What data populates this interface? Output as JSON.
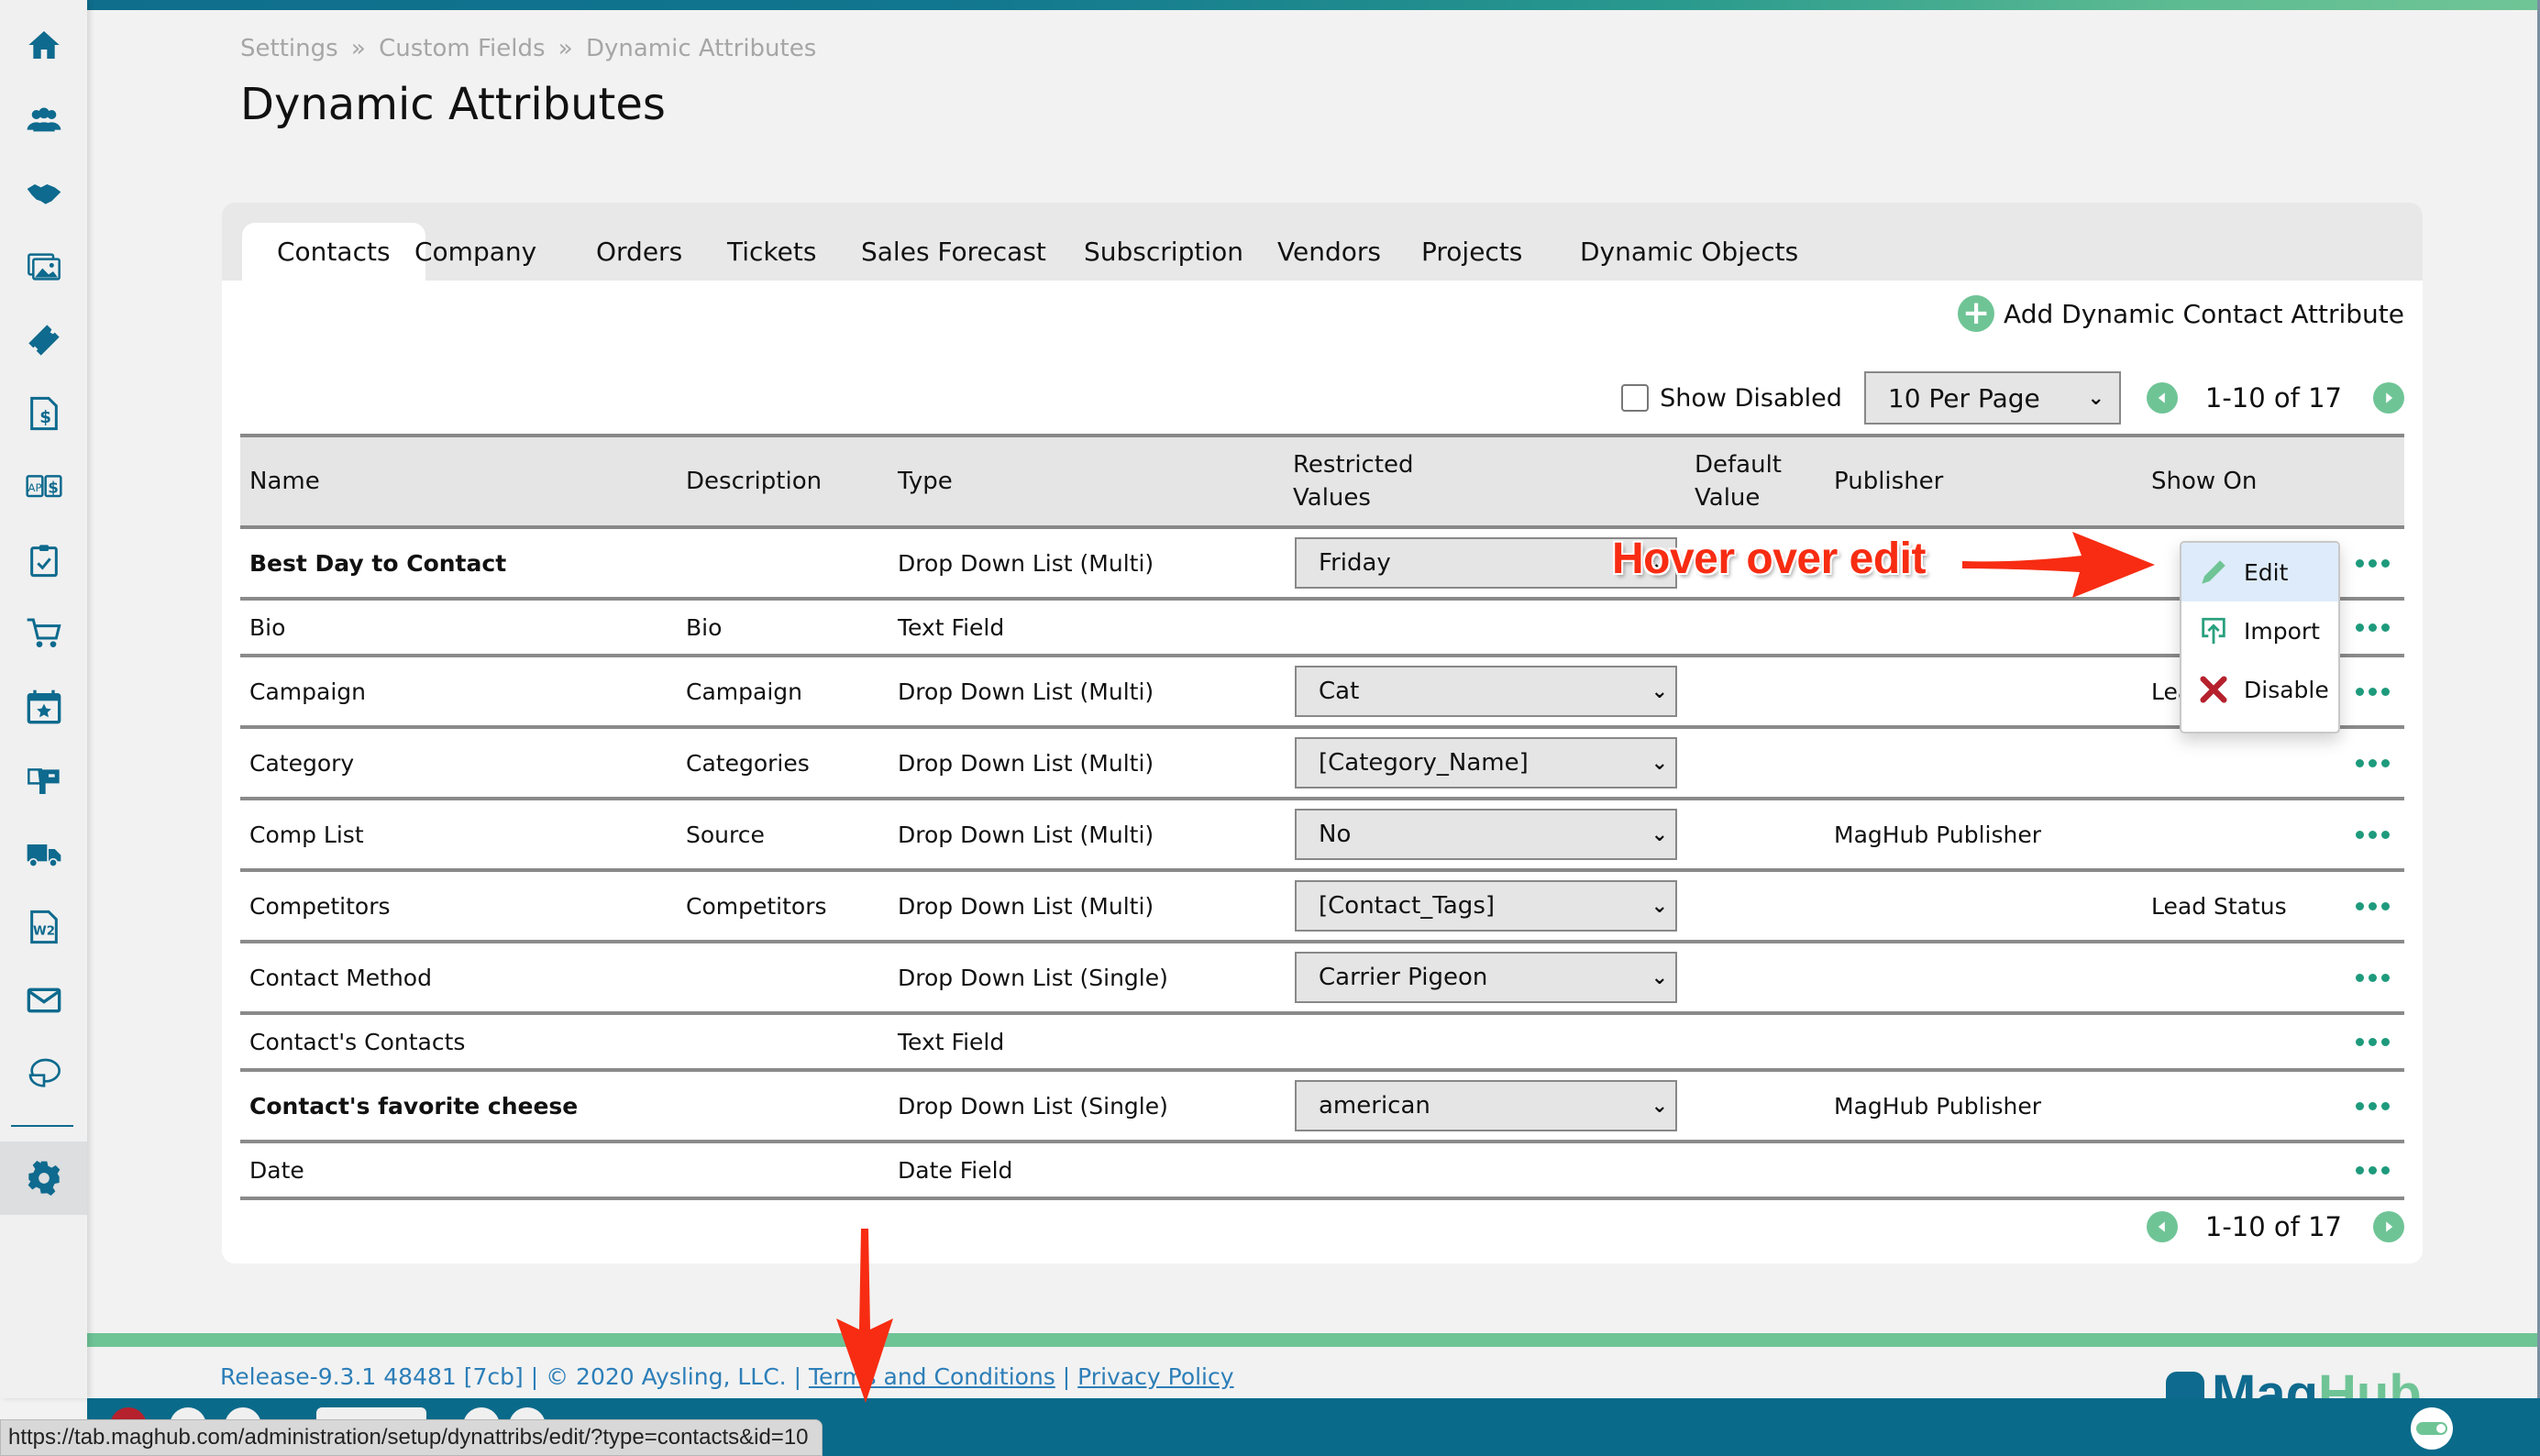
{
  "breadcrumb": [
    "Settings",
    "Custom Fields",
    "Dynamic Attributes"
  ],
  "breadcrumb_separator": "»",
  "page_title": "Dynamic Attributes",
  "sidebar": {
    "items": [
      {
        "icon": "home-icon"
      },
      {
        "icon": "contacts-icon"
      },
      {
        "icon": "handshake-icon"
      },
      {
        "icon": "media-icon"
      },
      {
        "icon": "ticket-icon"
      },
      {
        "icon": "invoice-icon"
      },
      {
        "icon": "ap-ar-icon"
      },
      {
        "icon": "clipboard-check-icon"
      },
      {
        "icon": "cart-icon"
      },
      {
        "icon": "calendar-star-icon"
      },
      {
        "icon": "mailbox-icon"
      },
      {
        "icon": "truck-icon"
      },
      {
        "icon": "w2-form-icon"
      },
      {
        "icon": "envelope-icon"
      },
      {
        "icon": "pie-chart-icon"
      },
      {
        "icon": "gear-icon",
        "active": true
      }
    ]
  },
  "tabs": [
    {
      "label": "Contacts",
      "active": true
    },
    {
      "label": "Company"
    },
    {
      "label": "Orders"
    },
    {
      "label": "Tickets"
    },
    {
      "label": "Sales Forecast"
    },
    {
      "label": "Subscription"
    },
    {
      "label": "Vendors"
    },
    {
      "label": "Projects"
    },
    {
      "label": "Dynamic Objects"
    }
  ],
  "add_button_label": "Add Dynamic Contact Attribute",
  "show_disabled_label": "Show Disabled",
  "show_disabled_checked": false,
  "per_page": "10 Per Page",
  "pagination": "1-10 of 17",
  "table": {
    "headers": [
      "Name",
      "Description",
      "Type",
      "Restricted\nValues",
      "Default\nValue",
      "Publisher",
      "Show On"
    ],
    "header_lines": {
      "restricted": [
        "Restricted",
        "Values"
      ],
      "default": [
        "Default",
        "Value"
      ]
    },
    "rows": [
      {
        "name": "Best Day to Contact",
        "bold": true,
        "description": "",
        "type": "Drop Down List (Multi)",
        "restricted": "Friday",
        "default": "",
        "publisher": "",
        "show_on": ""
      },
      {
        "name": "Bio",
        "description": "Bio",
        "type": "Text Field",
        "restricted": "",
        "default": "",
        "publisher": "",
        "show_on": ""
      },
      {
        "name": "Campaign",
        "description": "Campaign",
        "type": "Drop Down List (Multi)",
        "restricted": "Cat",
        "default": "",
        "publisher": "",
        "show_on": "Lead Status"
      },
      {
        "name": "Category",
        "description": "Categories",
        "type": "Drop Down List (Multi)",
        "restricted": "[Category_Name]",
        "default": "",
        "publisher": "",
        "show_on": ""
      },
      {
        "name": "Comp List",
        "description": "Source",
        "type": "Drop Down List (Multi)",
        "restricted": "No",
        "default": "",
        "publisher": "MagHub Publisher",
        "show_on": ""
      },
      {
        "name": "Competitors",
        "description": "Competitors",
        "type": "Drop Down List (Multi)",
        "restricted": "[Contact_Tags]",
        "default": "",
        "publisher": "",
        "show_on": "Lead Status"
      },
      {
        "name": "Contact Method",
        "description": "",
        "type": "Drop Down List (Single)",
        "restricted": "Carrier Pigeon",
        "default": "",
        "publisher": "",
        "show_on": ""
      },
      {
        "name": "Contact's Contacts",
        "description": "",
        "type": "Text Field",
        "restricted": "",
        "default": "",
        "publisher": "",
        "show_on": ""
      },
      {
        "name": "Contact's favorite cheese",
        "bold": true,
        "description": "",
        "type": "Drop Down List (Single)",
        "restricted": "american",
        "default": "",
        "publisher": "MagHub Publisher",
        "show_on": ""
      },
      {
        "name": "Date",
        "description": "",
        "type": "Date Field",
        "restricted": "",
        "default": "",
        "publisher": "",
        "show_on": ""
      }
    ]
  },
  "row_menu": {
    "items": [
      {
        "label": "Edit",
        "icon": "pencil-icon",
        "hovered": true
      },
      {
        "label": "Import",
        "icon": "import-icon"
      },
      {
        "label": "Disable",
        "icon": "x-icon"
      }
    ]
  },
  "annotation": {
    "text": "Hover over edit",
    "color": "#f72c12"
  },
  "footer": {
    "release": "Release-9.3.1 48481 [7cb]",
    "copyright": "© 2020 Aysling, LLC.",
    "terms_link": "Terms and Conditions",
    "privacy_link": "Privacy Policy",
    "separator": "|"
  },
  "logo": {
    "mag": "Mag",
    "hub": "Hub"
  },
  "status_url": "https://tab.maghub.com/administration/setup/dynattribs/edit/?type=contacts&id=10",
  "colors": {
    "brand_blue": "#0e6a8e",
    "brand_green": "#6fc496",
    "link_blue": "#2c7eb8",
    "dots_green": "#1e9a7c",
    "disable_red": "#b5222d"
  }
}
